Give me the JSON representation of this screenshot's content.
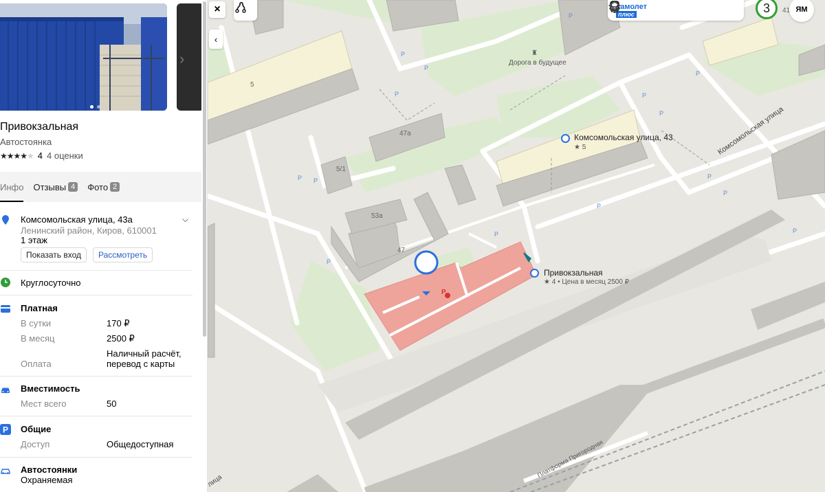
{
  "place": {
    "name": "Привокзальная",
    "category": "Автостоянка",
    "rating_value": "4",
    "rating_stars": 4,
    "rating_count": "4 оценки"
  },
  "tabs": [
    {
      "label": "Инфо",
      "badge": ""
    },
    {
      "label": "Отзывы",
      "badge": "4"
    },
    {
      "label": "Фото",
      "badge": "2"
    }
  ],
  "address": {
    "street": "Комсомольская улица, 43а",
    "district": "Ленинский район, Киров, 610001",
    "floor": "1 этаж",
    "show_entrance": "Показать вход",
    "view": "Рассмотреть"
  },
  "hours": "Круглосуточно",
  "payment": {
    "title": "Платная",
    "per_day_label": "В сутки",
    "per_day_value": "170 ₽",
    "per_month_label": "В месяц",
    "per_month_value": "2500 ₽",
    "method_label": "Оплата",
    "method_value_1": "Наличный расчёт,",
    "method_value_2": "перевод с карты"
  },
  "capacity": {
    "title": "Вместимость",
    "label": "Мест всего",
    "value": "50"
  },
  "general": {
    "title": "Общие",
    "label": "Доступ",
    "value": "Общедоступная"
  },
  "parking": {
    "title": "Автостоянки",
    "value": "Охраняемая"
  },
  "map": {
    "promo_top": "самолет",
    "promo_bottom": "плюс",
    "traffic_level": "3",
    "ym_label": "ЯМ",
    "poi_house": "Комсомольская улица, 43",
    "poi_house_sub": "★ 5",
    "poi_parking": "Привокзальная",
    "poi_parking_sub": "★ 4 • Цена в месяц 2500 ₽",
    "street_label": "Комсомольская улица",
    "platform_label": "Платформа Пригородная",
    "landmark": "Дорога в будущее",
    "street_fragment": "лица",
    "bld_5": "5",
    "bld_47a": "47а",
    "bld_51": "5/1",
    "bld_53a": "53а",
    "bld_47": "47",
    "edge_num": "41",
    "parking_p": "P"
  },
  "colors": {
    "accent_blue": "#2b6fe0",
    "parking_area": "#eea49b",
    "traffic_green": "#2f9e34",
    "rail_dark": "#c6c4bf"
  }
}
